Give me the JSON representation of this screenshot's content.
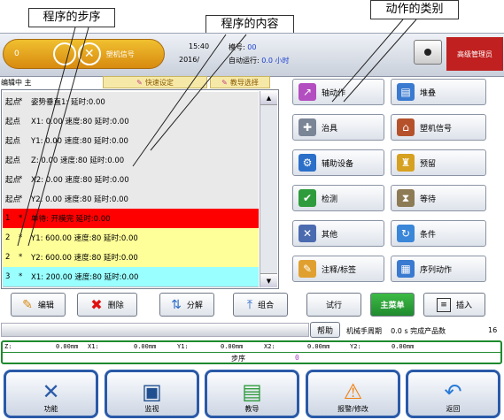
{
  "callouts": {
    "program_steps": "程序的步序",
    "program_content": "程序的内容",
    "action_categories": "动作的类别"
  },
  "header": {
    "left_value": "0",
    "machine_signal": "塑机信号",
    "time": "15:40",
    "date": "2016/",
    "mold_label": "模号:",
    "mold_value": "00",
    "auto_run_label": "自动运行:",
    "auto_run_value": "0.0 小时",
    "user_role": "高级管理员"
  },
  "editor": {
    "status": "编辑中 主",
    "quick_setting": "快速设定",
    "teach_select": "教导选择"
  },
  "program_rows": [
    {
      "n": "起点",
      "d": "*",
      "text": "姿势垂直1: 延时:0.00",
      "bg": "#e9e9e9"
    },
    {
      "n": "起点",
      "d": "",
      "text": "X1: 0.00 速度:80  延时:0.00",
      "bg": "#e9e9e9"
    },
    {
      "n": "起点",
      "d": "",
      "text": "Y1: 0.00 速度:80  延时:0.00",
      "bg": "#e9e9e9"
    },
    {
      "n": "起点",
      "d": "",
      "text": "Z: 0.00 速度:80  延时:0.00",
      "bg": "#e9e9e9"
    },
    {
      "n": "起点",
      "d": "*",
      "text": "X2: 0.00 速度:80  延时:0.00",
      "bg": "#e9e9e9"
    },
    {
      "n": "起点",
      "d": "*",
      "text": "Y2: 0.00 速度:80  延时:0.00",
      "bg": "#e9e9e9"
    },
    {
      "n": "1",
      "d": "*",
      "text": "单待: 开模完 延时:0.00",
      "bg": "#ff0000"
    },
    {
      "n": "2",
      "d": "*",
      "text": "Y1: 600.00 速度:80  延时:0.00",
      "bg": "#ffff99"
    },
    {
      "n": "2",
      "d": "*",
      "text": "Y2: 600.00 速度:80  延时:0.00",
      "bg": "#ffff99"
    },
    {
      "n": "3",
      "d": "*",
      "text": "X1: 200.00 速度:80  延时:0.00",
      "bg": "#99ffff"
    }
  ],
  "categories": [
    {
      "label": "轴动作",
      "icon": "axis-icon",
      "color": "#b34ec0"
    },
    {
      "label": "堆叠",
      "icon": "stack-icon",
      "color": "#3a7ad0"
    },
    {
      "label": "治具",
      "icon": "fixture-icon",
      "color": "#7a8596"
    },
    {
      "label": "塑机信号",
      "icon": "factory-icon",
      "color": "#b5522c"
    },
    {
      "label": "辅助设备",
      "icon": "aux-device-icon",
      "color": "#2b6fc8"
    },
    {
      "label": "预留",
      "icon": "robot-icon",
      "color": "#d6a020"
    },
    {
      "label": "检测",
      "icon": "shield-icon",
      "color": "#2e9c3c"
    },
    {
      "label": "等待",
      "icon": "hourglass-icon",
      "color": "#8d7b55"
    },
    {
      "label": "其他",
      "icon": "tools-icon",
      "color": "#4b6bb0"
    },
    {
      "label": "条件",
      "icon": "condition-icon",
      "color": "#3a86d8"
    },
    {
      "label": "注释/标签",
      "icon": "pencil-icon",
      "color": "#e0a030"
    },
    {
      "label": "序列动作",
      "icon": "sequence-icon",
      "color": "#3a7ad0"
    }
  ],
  "toolbar": {
    "edit": "编辑",
    "delete": "删除",
    "split": "分解",
    "combine": "组合",
    "trial": "试行",
    "main_menu": "主菜单",
    "insert": "插入"
  },
  "status": {
    "help": "帮助",
    "cycle_label": "机械手周期",
    "cycle_value": "0.0 s",
    "finished_label": "完成产品数",
    "finished_value": "16"
  },
  "positions": {
    "z_label": "Z:",
    "z_value": "0.00mm",
    "x1_label": "X1:",
    "x1_value": "0.00mm",
    "y1_label": "Y1:",
    "y1_value": "0.00mm",
    "x2_label": "X2:",
    "x2_value": "0.00mm",
    "y2_label": "Y2:",
    "y2_value": "0.00mm"
  },
  "step_label": "步序",
  "step_value": "0",
  "nav": [
    {
      "label": "功能",
      "icon": "function-tools-icon"
    },
    {
      "label": "监视",
      "icon": "monitor-icon"
    },
    {
      "label": "教导",
      "icon": "teach-icon"
    },
    {
      "label": "报警/修改",
      "icon": "alarm-icon"
    },
    {
      "label": "返回",
      "icon": "return-icon"
    }
  ],
  "colors": {
    "accent_blue": "#2a5aa8",
    "nav_green": "#1f8a2e",
    "alarm_red": "#ff0000",
    "highlight_yellow": "#ffff99",
    "highlight_cyan": "#99ffff",
    "role_bg": "#c02020"
  }
}
